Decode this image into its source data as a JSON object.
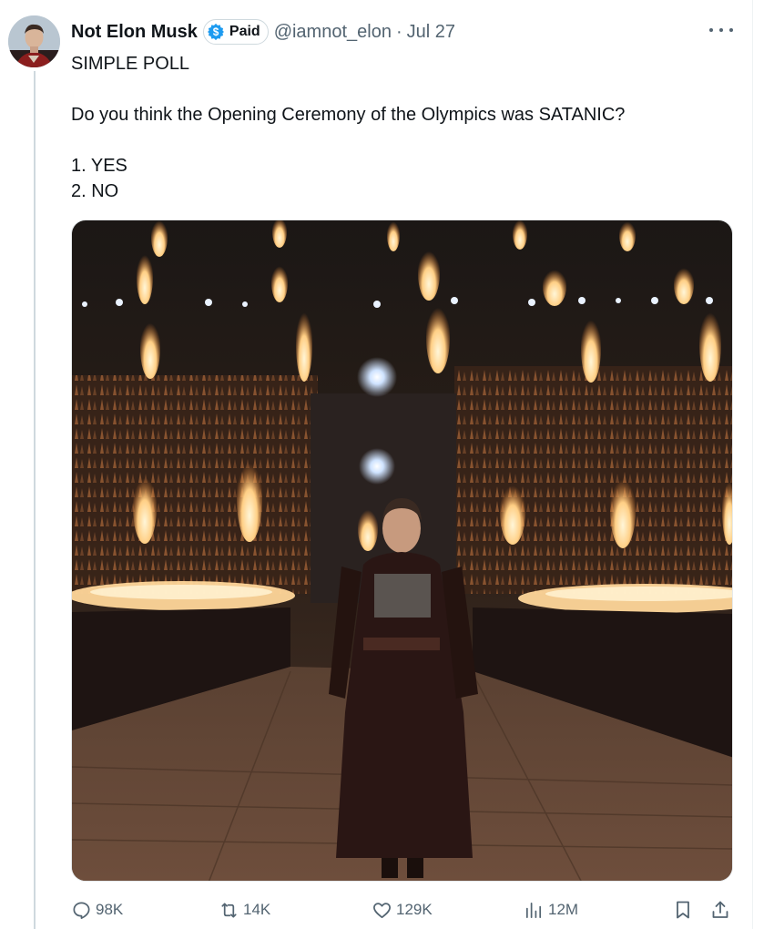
{
  "tweet": {
    "author": {
      "display_name": "Not Elon Musk",
      "badge_label": "Paid",
      "handle": "@iamnot_elon",
      "separator": "·",
      "date": "Jul 27"
    },
    "text_lines": [
      "SIMPLE POLL",
      "",
      "Do you think the Opening Ceremony of the Olympics was SATANIC?",
      "",
      "1. YES",
      "2. NO"
    ],
    "media": {
      "description": "",
      "icon": "photo"
    },
    "stats": {
      "replies": "98K",
      "reposts": "14K",
      "likes": "129K",
      "views": "12M"
    },
    "icons": {
      "reply": "reply-icon",
      "repost": "repost-icon",
      "like": "heart-icon",
      "views": "views-icon",
      "bookmark": "bookmark-icon",
      "share": "share-icon",
      "more": "more-icon",
      "badge": "dollar-icon"
    }
  },
  "colors": {
    "text_primary": "#0f1419",
    "text_secondary": "#536471",
    "badge_blue": "#1d9bf0",
    "divider": "#cfd9de"
  }
}
